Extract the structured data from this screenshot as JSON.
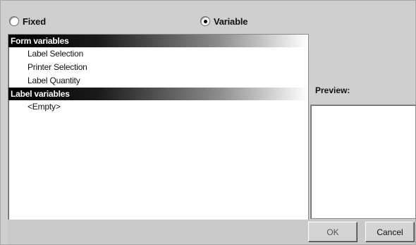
{
  "mode": {
    "fixed_label": "Fixed",
    "variable_label": "Variable",
    "selected": "variable"
  },
  "variables": {
    "groups": [
      {
        "header": "Form variables",
        "items": [
          "Label Selection",
          "Printer Selection",
          "Label Quantity"
        ]
      },
      {
        "header": "Label variables",
        "items": [
          "<Empty>"
        ]
      }
    ]
  },
  "preview": {
    "label": "Preview:"
  },
  "buttons": {
    "ok_label": "OK",
    "cancel_label": "Cancel"
  }
}
